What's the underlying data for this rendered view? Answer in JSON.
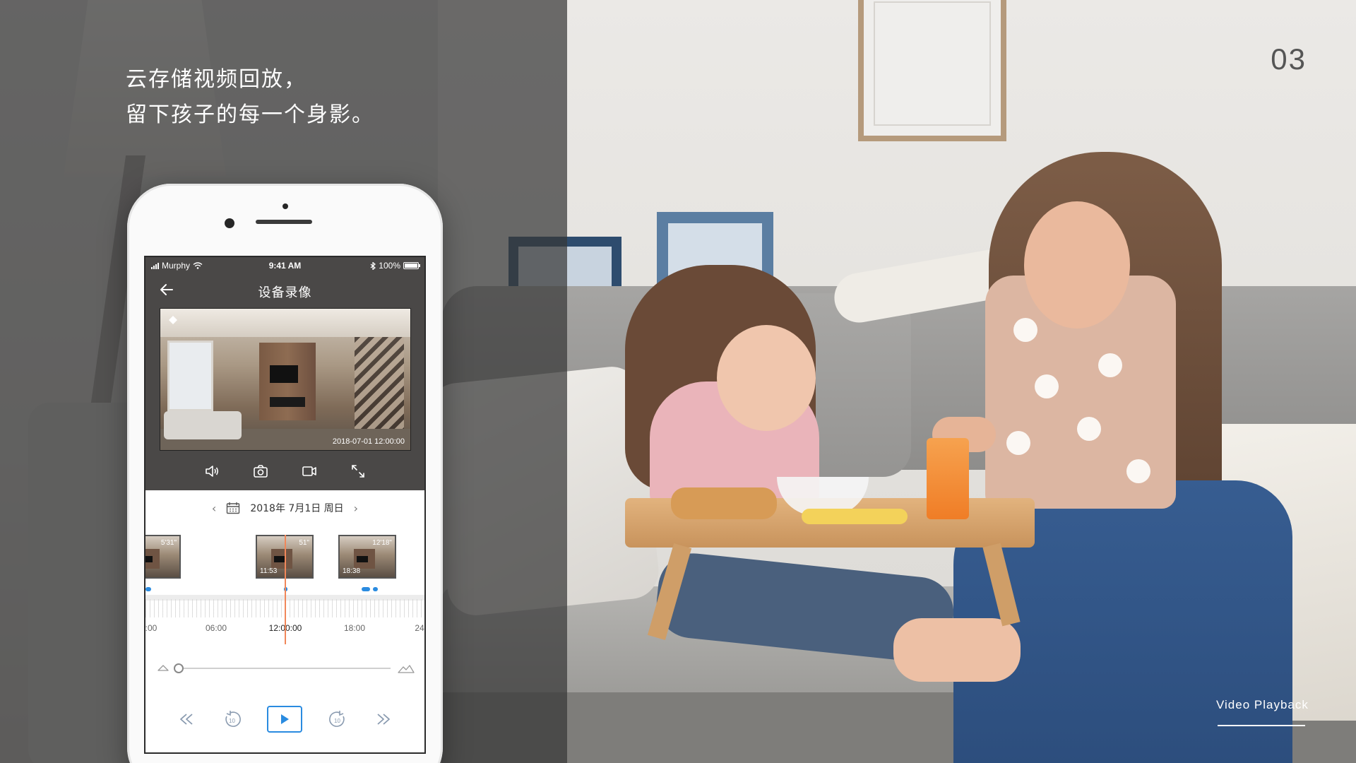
{
  "headline": {
    "line1": "云存储视频回放，",
    "line2": "留下孩子的每一个身影。"
  },
  "page_number": "03",
  "tagline": "Video Playback",
  "phone": {
    "status_bar": {
      "carrier": "Murphy",
      "time": "9:41 AM",
      "battery": "100%"
    },
    "nav": {
      "title": "设备录像",
      "back_icon": "back-arrow-icon"
    },
    "video": {
      "timestamp": "2018-07-01 12:00:00"
    },
    "controls": [
      "volume-icon",
      "snapshot-icon",
      "record-icon",
      "fullscreen-icon"
    ],
    "date": {
      "label": "2018年 7月1日 周日",
      "prev_icon": "chevron-left-icon",
      "next_icon": "chevron-right-icon"
    },
    "thumbnails": [
      {
        "duration": "5'31\"",
        "time": ""
      },
      {
        "duration": "51\"",
        "time": "11:53"
      },
      {
        "duration": "12'18\"",
        "time": "18:38"
      }
    ],
    "timeline": {
      "labels": [
        ":00",
        "06:00",
        "12:00:00",
        "18:00",
        "24"
      ],
      "current_label": "12:00:00"
    },
    "playback_buttons": [
      "rewind-icon",
      "back-10-icon",
      "play-icon",
      "forward-10-icon",
      "fast-forward-icon"
    ],
    "accent_color": "#2a8be0",
    "playhead_color": "#f0875a"
  }
}
